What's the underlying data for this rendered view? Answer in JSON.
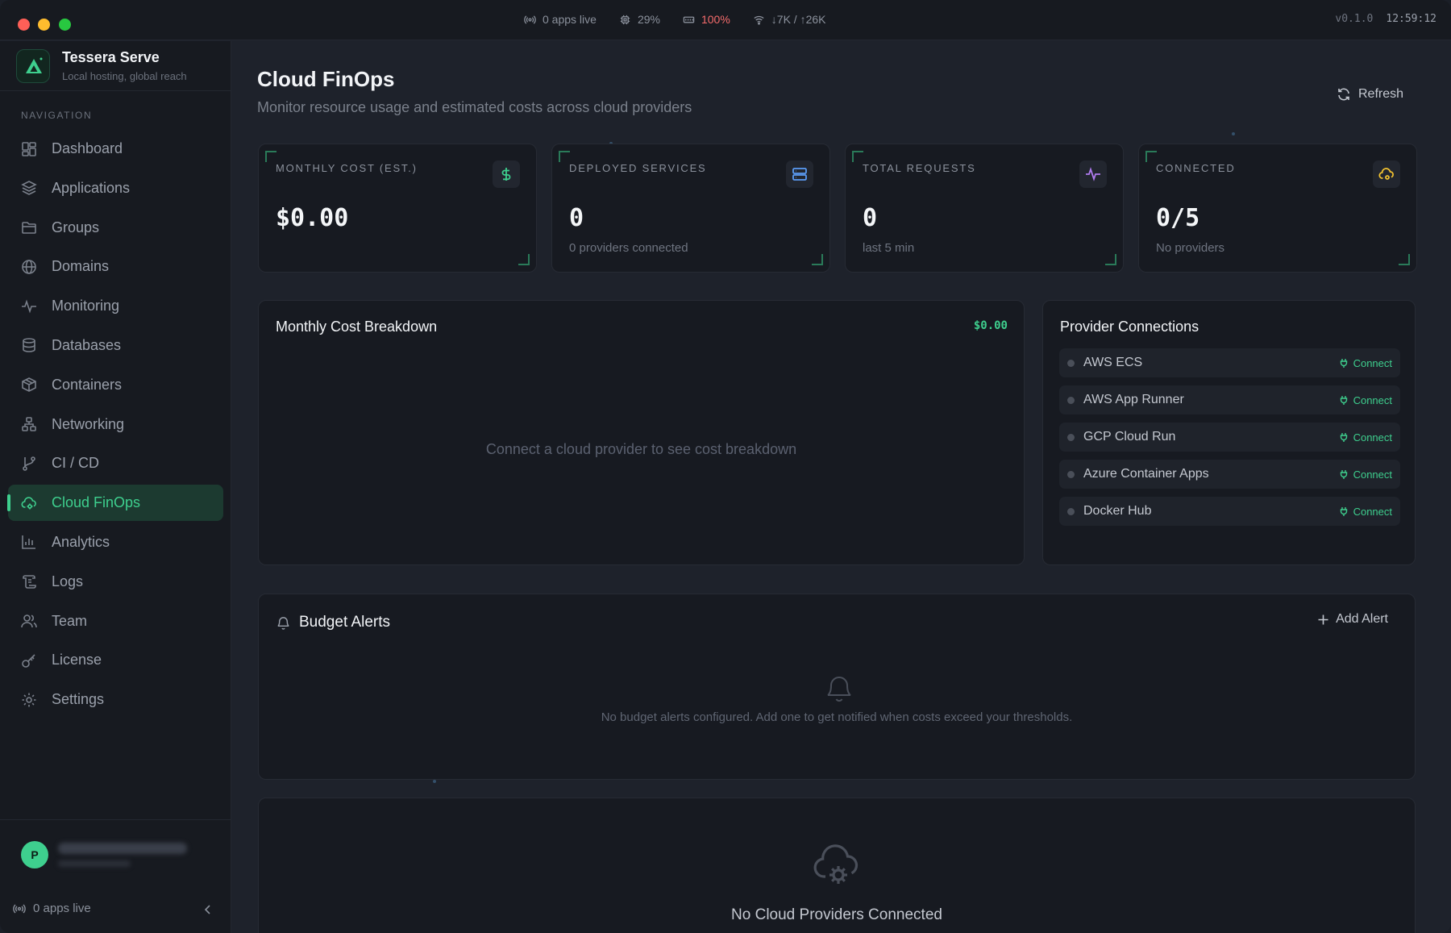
{
  "titlebar": {
    "status": [
      {
        "icon": "broadcast-icon",
        "text": "0 apps live"
      },
      {
        "icon": "cpu-icon",
        "text": "29%"
      },
      {
        "icon": "memory-icon",
        "text": "100%"
      },
      {
        "icon": "wifi-icon",
        "text": "↓7K / ↑26K"
      }
    ],
    "version": "v0.1.0",
    "clock": "12:59:12"
  },
  "brand": {
    "name": "Tessera Serve",
    "tagline": "Local hosting, global reach"
  },
  "sidebar": {
    "heading": "NAVIGATION",
    "items": [
      {
        "label": "Dashboard",
        "icon": "dashboard-icon"
      },
      {
        "label": "Applications",
        "icon": "layers-icon"
      },
      {
        "label": "Groups",
        "icon": "folder-icon"
      },
      {
        "label": "Domains",
        "icon": "globe-icon"
      },
      {
        "label": "Monitoring",
        "icon": "pulse-icon"
      },
      {
        "label": "Databases",
        "icon": "database-icon"
      },
      {
        "label": "Containers",
        "icon": "box-icon"
      },
      {
        "label": "Networking",
        "icon": "network-icon"
      },
      {
        "label": "CI / CD",
        "icon": "git-branch-icon"
      },
      {
        "label": "Cloud FinOps",
        "icon": "cloud-cog-icon",
        "active": true
      },
      {
        "label": "Analytics",
        "icon": "bar-chart-icon"
      },
      {
        "label": "Logs",
        "icon": "scroll-icon"
      },
      {
        "label": "Team",
        "icon": "users-icon"
      },
      {
        "label": "License",
        "icon": "key-icon"
      },
      {
        "label": "Settings",
        "icon": "gear-icon"
      }
    ],
    "user_initial": "P",
    "footer_live": "0 apps live"
  },
  "page": {
    "title": "Cloud FinOps",
    "subtitle": "Monitor resource usage and estimated costs across cloud providers",
    "refresh_label": "Refresh"
  },
  "stats": [
    {
      "label": "MONTHLY COST (EST.)",
      "value": "$0.00",
      "sub": "",
      "icon": "dollar-icon",
      "color": "#3ecf8e"
    },
    {
      "label": "DEPLOYED SERVICES",
      "value": "0",
      "sub": "0 providers connected",
      "icon": "server-icon",
      "color": "#5b9cf5"
    },
    {
      "label": "TOTAL REQUESTS",
      "value": "0",
      "sub": "last 5 min",
      "icon": "activity-icon",
      "color": "#b07cf0"
    },
    {
      "label": "CONNECTED",
      "value": "0/5",
      "sub": "No providers",
      "icon": "cloud-cog-icon",
      "color": "#f2c230"
    }
  ],
  "breakdown": {
    "title": "Monthly Cost Breakdown",
    "total": "$0.00",
    "empty": "Connect a cloud provider to see cost breakdown"
  },
  "providers": {
    "title": "Provider Connections",
    "connect_label": "Connect",
    "items": [
      "AWS ECS",
      "AWS App Runner",
      "GCP Cloud Run",
      "Azure Container Apps",
      "Docker Hub"
    ]
  },
  "budget": {
    "title": "Budget Alerts",
    "add_label": "Add Alert",
    "empty": "No budget alerts configured. Add one to get notified when costs exceed your thresholds."
  },
  "no_cloud": {
    "title": "No Cloud Providers Connected"
  },
  "colors": {
    "accent": "#3ecf8e",
    "danger": "#f46b6b"
  }
}
